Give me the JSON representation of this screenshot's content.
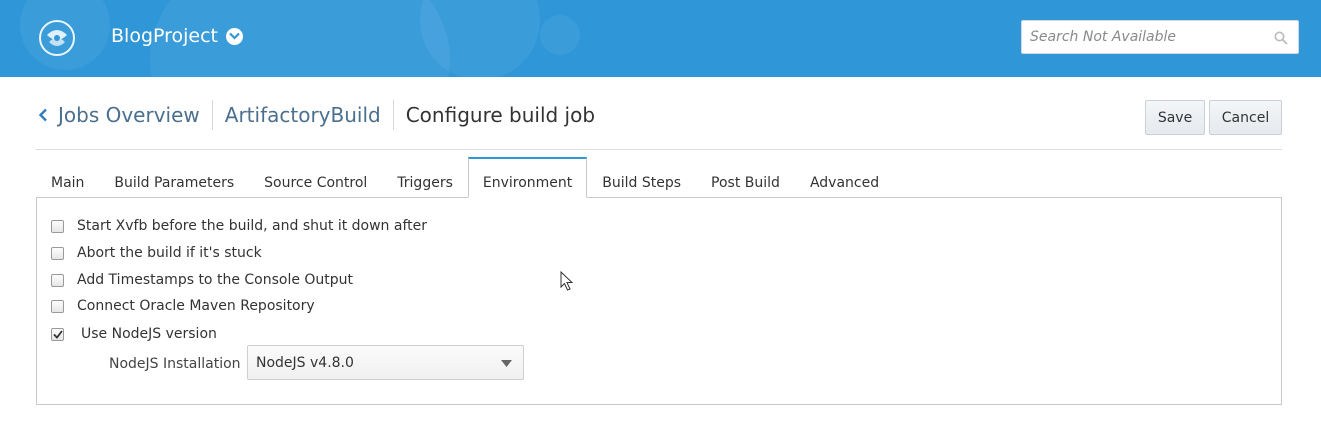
{
  "header": {
    "project_name": "BlogProject",
    "search_placeholder": "Search Not Available",
    "bg_color": "#2f96d8"
  },
  "breadcrumb": {
    "back_label": "Jobs Overview",
    "job_label": "ArtifactoryBuild",
    "current_label": "Configure build job"
  },
  "actions": {
    "save_label": "Save",
    "cancel_label": "Cancel"
  },
  "tabs": [
    {
      "label": "Main",
      "active": false
    },
    {
      "label": "Build Parameters",
      "active": false
    },
    {
      "label": "Source Control",
      "active": false
    },
    {
      "label": "Triggers",
      "active": false
    },
    {
      "label": "Environment",
      "active": true
    },
    {
      "label": "Build Steps",
      "active": false
    },
    {
      "label": "Post Build",
      "active": false
    },
    {
      "label": "Advanced",
      "active": false
    }
  ],
  "environment": {
    "options": [
      {
        "label": "Start Xvfb before the build, and shut it down after",
        "checked": false
      },
      {
        "label": "Abort the build if it's stuck",
        "checked": false
      },
      {
        "label": "Add Timestamps to the Console Output",
        "checked": false
      },
      {
        "label": "Connect Oracle Maven Repository",
        "checked": false
      },
      {
        "label": "Use NodeJS version",
        "checked": true
      }
    ],
    "nodejs_label": "NodeJS Installation",
    "nodejs_value": "NodeJS v4.8.0"
  }
}
